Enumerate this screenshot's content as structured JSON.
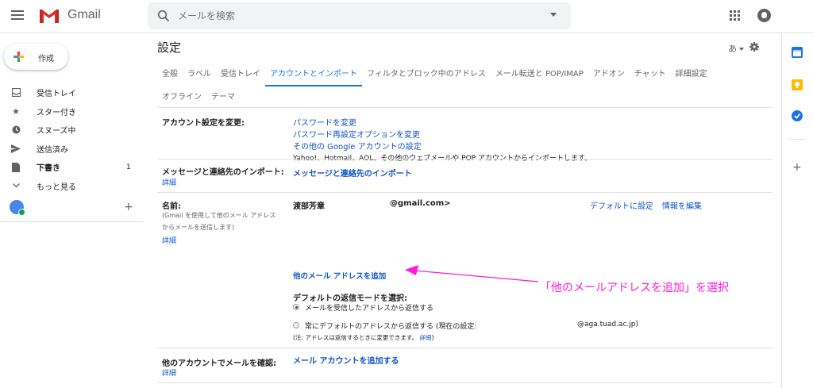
{
  "header": {
    "app_name": "Gmail",
    "search_placeholder": "メールを検索"
  },
  "colors": {
    "gmail_red": "#d93025",
    "link_blue": "#1155cc",
    "active_tab": "#1a73e8",
    "annotation_magenta": "#ff1ad9"
  },
  "sidebar": {
    "compose_label": "作成",
    "items": [
      {
        "icon": "inbox-icon",
        "label": "受信トレイ",
        "count": ""
      },
      {
        "icon": "star-icon",
        "label": "スター付き",
        "count": ""
      },
      {
        "icon": "clock-icon",
        "label": "スヌーズ中",
        "count": ""
      },
      {
        "icon": "send-icon",
        "label": "送信済み",
        "count": ""
      },
      {
        "icon": "draft-icon",
        "label": "下書き",
        "count": "1"
      },
      {
        "icon": "chevron-down-icon",
        "label": "もっと見る",
        "count": ""
      }
    ]
  },
  "settings": {
    "title": "設定",
    "lang_label": "あ",
    "tabs_row1": [
      "全般",
      "ラベル",
      "受信トレイ",
      "アカウントとインポート",
      "フィルタとブロック中のアドレス",
      "メール転送と POP/IMAP",
      "アドオン",
      "チャット",
      "詳細設定"
    ],
    "tabs_row2": [
      "オフライン",
      "テーマ"
    ],
    "active_tab": "アカウントとインポート",
    "account": {
      "label": "アカウント設定を変更:",
      "links": [
        "パスワードを変更",
        "パスワード再設定オプションを変更",
        "その他の Google アカウントの設定"
      ]
    },
    "import": {
      "label": "メッセージと連絡先のインポート:",
      "detail": "詳細",
      "description": "Yahoo!、Hotmail、AOL、その他のウェブメールや POP アカウントからインポートします。",
      "link": "メッセージと連絡先のインポート"
    },
    "send_as": {
      "label": "名前:",
      "sub1": "(Gmail を使用して他のメール アドレス",
      "sub2": "からメールを送信します)",
      "detail": "詳細",
      "name": "渡部芳章",
      "email": "@gmail.com>",
      "set_default": "デフォルトに設定",
      "edit_info": "情報を編集",
      "add_address": "他のメール アドレスを追加",
      "reply_mode_label": "デフォルトの返信モードを選択:",
      "reply_option1": "メールを受信したアドレスから返信する",
      "reply_option2": "常にデフォルトのアドレスから返信する (現在の設定:",
      "current_setting_address": "@aga.tuad.ac.jp)",
      "note": "(注: アドレスは返信するときに変更できます。",
      "note_detail": "詳細",
      "note_close": ")"
    },
    "check_mail": {
      "label": "他のアカウントでメールを確認:",
      "detail": "詳細",
      "link": "メール アカウントを追加する"
    }
  },
  "annotation": {
    "text": "「他のメールアドレスを追加」を選択"
  }
}
